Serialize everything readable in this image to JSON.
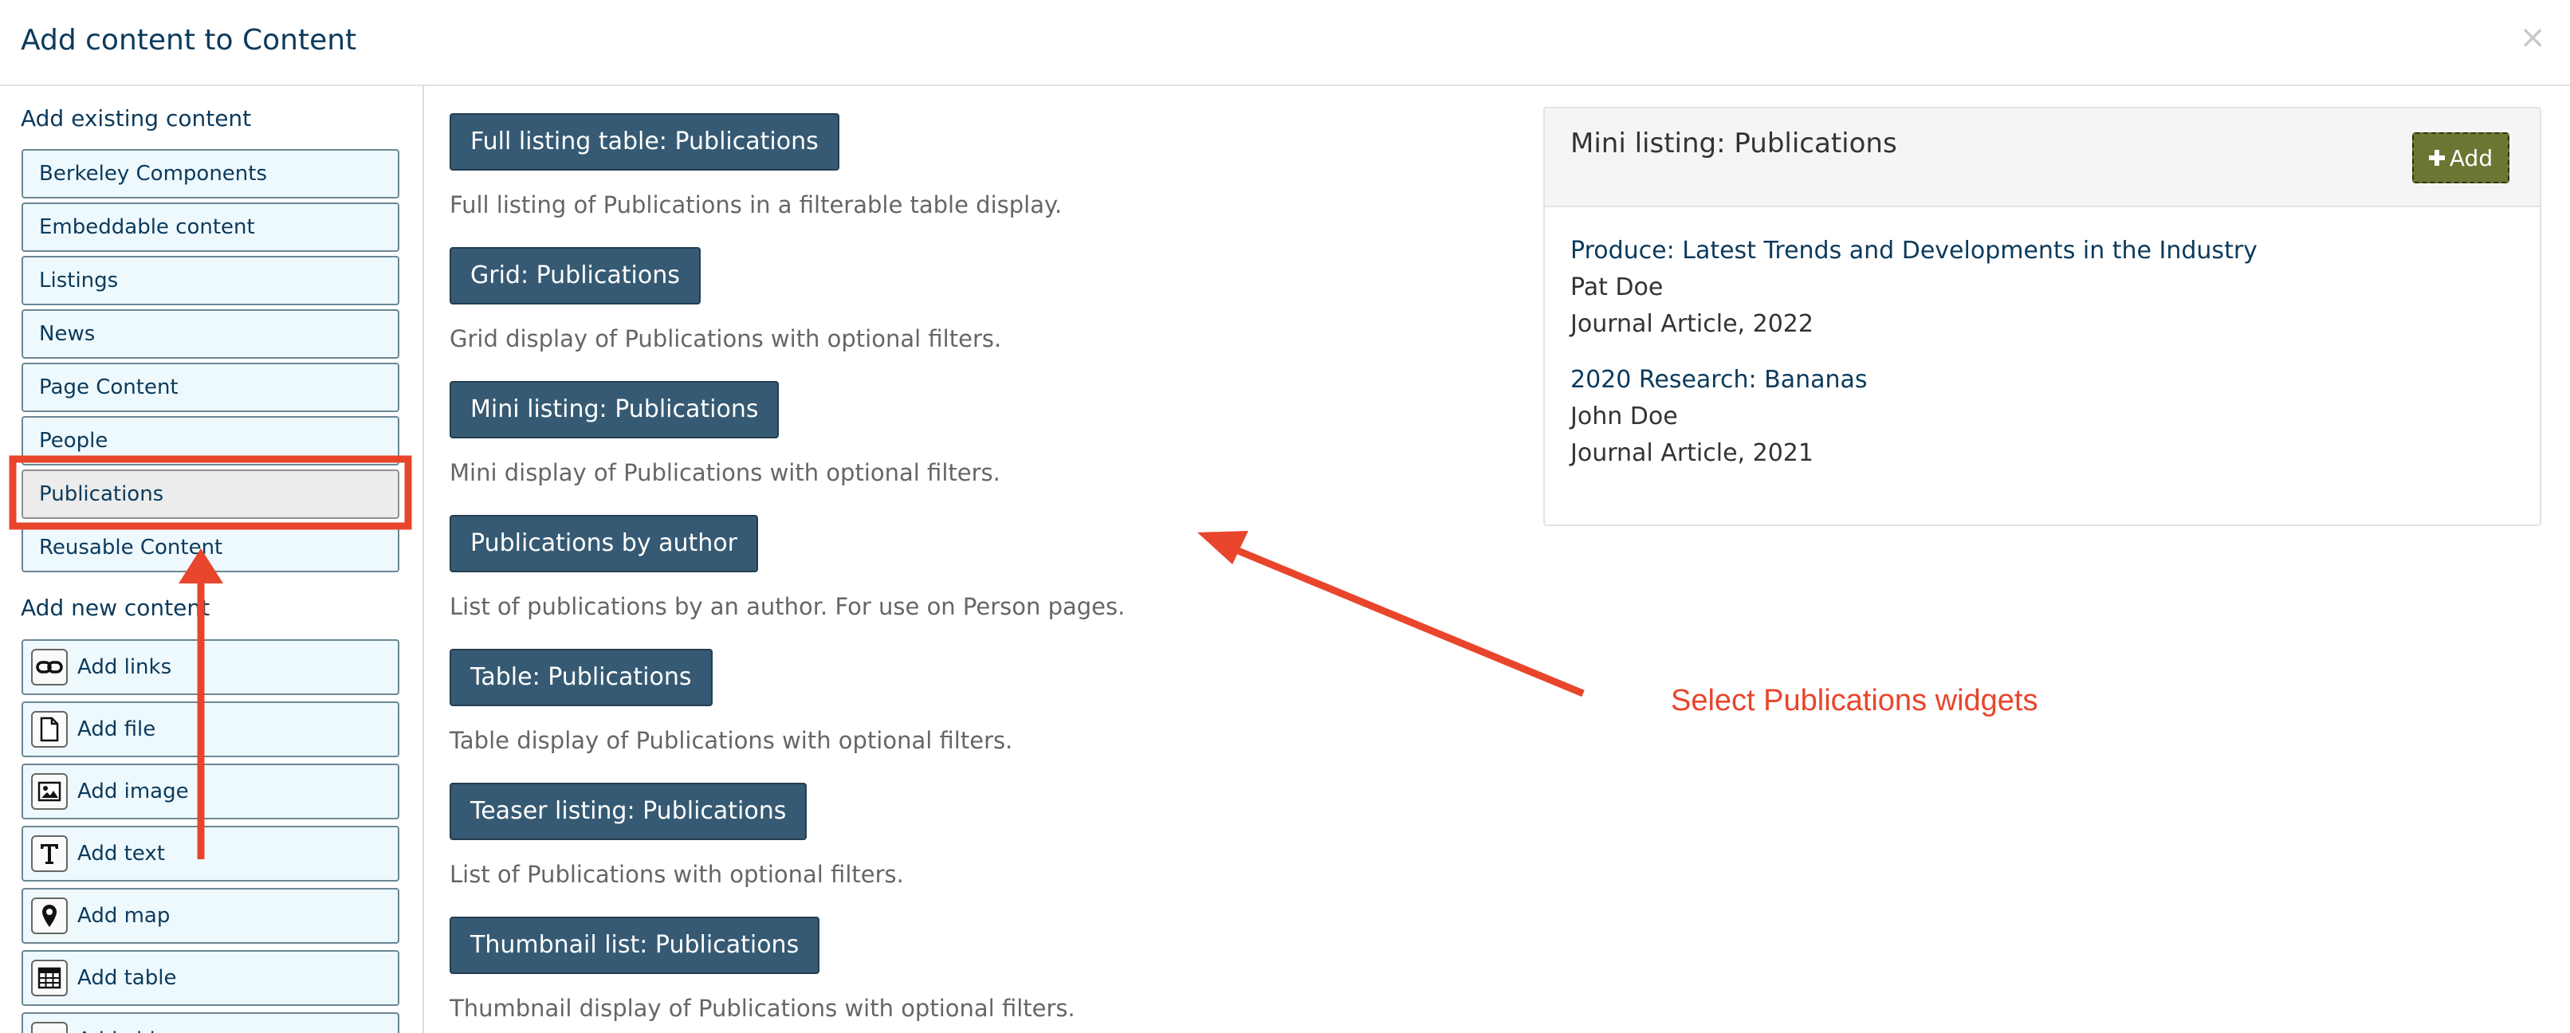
{
  "dialog": {
    "title": "Add content to Content",
    "close_glyph": "×"
  },
  "sidebar": {
    "existing_heading": "Add existing content",
    "existing_items": [
      {
        "label": "Berkeley Components",
        "selected": false
      },
      {
        "label": "Embeddable content",
        "selected": false
      },
      {
        "label": "Listings",
        "selected": false
      },
      {
        "label": "News",
        "selected": false
      },
      {
        "label": "Page Content",
        "selected": false
      },
      {
        "label": "People",
        "selected": false
      },
      {
        "label": "Publications",
        "selected": true
      },
      {
        "label": "Reusable Content",
        "selected": false
      }
    ],
    "new_heading": "Add new content",
    "new_items": [
      {
        "label": "Add links",
        "icon": "link-icon"
      },
      {
        "label": "Add file",
        "icon": "file-icon"
      },
      {
        "label": "Add image",
        "icon": "image-icon"
      },
      {
        "label": "Add text",
        "icon": "text-icon"
      },
      {
        "label": "Add map",
        "icon": "map-marker-icon"
      },
      {
        "label": "Add table",
        "icon": "table-icon"
      },
      {
        "label": "Add video",
        "icon": "video-icon"
      }
    ]
  },
  "widgets": [
    {
      "label": "Full listing table: Publications",
      "description": "Full listing of Publications in a filterable table display."
    },
    {
      "label": "Grid: Publications",
      "description": "Grid display of Publications with optional filters."
    },
    {
      "label": "Mini listing: Publications",
      "description": "Mini display of Publications with optional filters."
    },
    {
      "label": "Publications by author",
      "description": "List of publications by an author. For use on Person pages."
    },
    {
      "label": "Table: Publications",
      "description": "Table display of Publications with optional filters."
    },
    {
      "label": "Teaser listing: Publications",
      "description": "List of Publications with optional filters."
    },
    {
      "label": "Thumbnail list: Publications",
      "description": "Thumbnail display of Publications with optional filters."
    }
  ],
  "preview": {
    "title": "Mini listing: Publications",
    "add_label": "Add",
    "add_icon": "plus-icon",
    "items": [
      {
        "title": "Produce: Latest Trends and Developments in the Industry",
        "author": "Pat Doe",
        "meta": "Journal Article, 2022"
      },
      {
        "title": "2020 Research: Bananas",
        "author": "John Doe",
        "meta": "Journal Article, 2021"
      }
    ]
  },
  "annotation": {
    "text": "Select Publications widgets",
    "color": "#e8452c"
  },
  "colors": {
    "widget_button": "#365a73",
    "add_button": "#6d7533",
    "link": "#0b3a5c"
  }
}
